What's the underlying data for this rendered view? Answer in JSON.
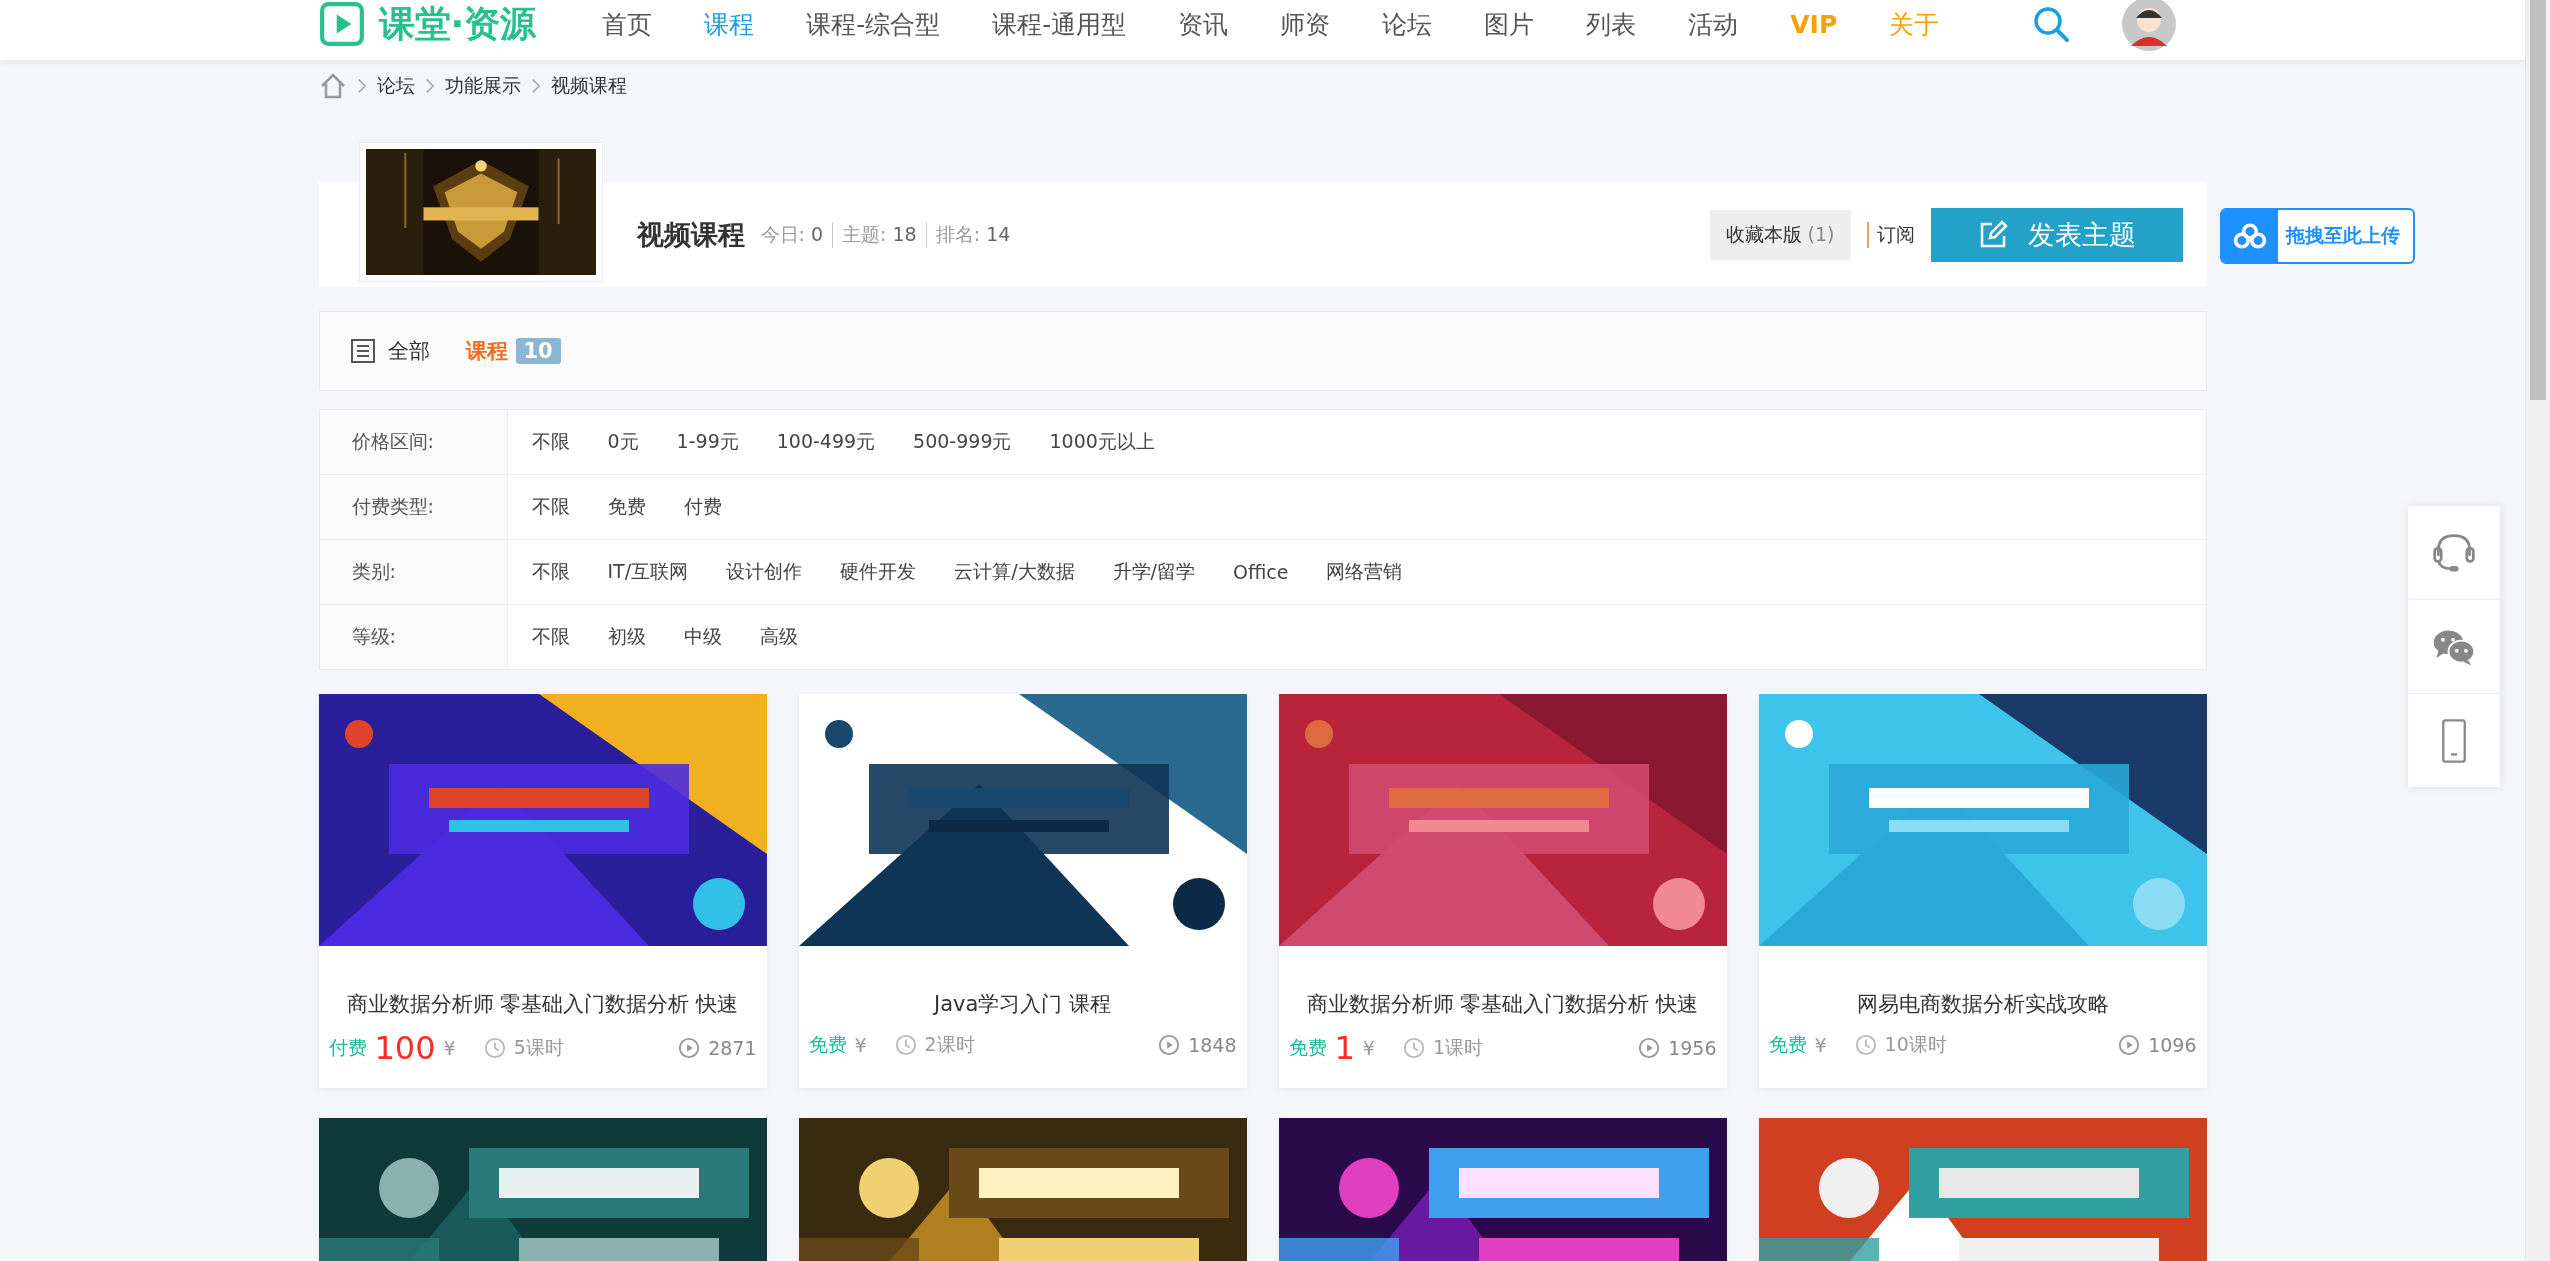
{
  "nav": {
    "logo": "课堂·资源",
    "items": [
      {
        "label": "首页",
        "selected": false,
        "kind": "normal"
      },
      {
        "label": "课程",
        "selected": true,
        "kind": "normal"
      },
      {
        "label": "课程-综合型",
        "selected": false,
        "kind": "normal"
      },
      {
        "label": "课程-通用型",
        "selected": false,
        "kind": "normal"
      },
      {
        "label": "资讯",
        "selected": false,
        "kind": "normal"
      },
      {
        "label": "师资",
        "selected": false,
        "kind": "normal"
      },
      {
        "label": "论坛",
        "selected": false,
        "kind": "normal"
      },
      {
        "label": "图片",
        "selected": false,
        "kind": "normal"
      },
      {
        "label": "列表",
        "selected": false,
        "kind": "normal"
      },
      {
        "label": "活动",
        "selected": false,
        "kind": "normal"
      },
      {
        "label": "VIP",
        "selected": false,
        "kind": "vip"
      },
      {
        "label": "关于",
        "selected": false,
        "kind": "highlight"
      }
    ]
  },
  "breadcrumb": [
    "论坛",
    "功能展示",
    "视频课程"
  ],
  "forum": {
    "title": "视频课程",
    "stats": [
      {
        "label": "今日:",
        "value": "0"
      },
      {
        "label": "主题:",
        "value": "18"
      },
      {
        "label": "排名:",
        "value": "14"
      }
    ],
    "favorite": {
      "label": "收藏本版",
      "count": "(1)"
    },
    "subscribe": "订阅",
    "post_button": "发表主题"
  },
  "upload_button": "拖拽至此上传",
  "tabs": [
    {
      "label": "全部",
      "selected": false
    },
    {
      "label": "课程",
      "selected": true,
      "count": "10"
    }
  ],
  "filters": [
    {
      "label": "价格区间:",
      "options": [
        "不限",
        "0元",
        "1-99元",
        "100-499元",
        "500-999元",
        "1000元以上"
      ]
    },
    {
      "label": "付费类型:",
      "options": [
        "不限",
        "免费",
        "付费"
      ]
    },
    {
      "label": "类别:",
      "options": [
        "不限",
        "IT/互联网",
        "设计创作",
        "硬件开发",
        "云计算/大数据",
        "升学/留学",
        "Office",
        "网络营销"
      ]
    },
    {
      "label": "等级:",
      "options": [
        "不限",
        "初级",
        "中级",
        "高级"
      ]
    }
  ],
  "courses": [
    {
      "title": "商业数据分析师 零基础入门数据分析 快速",
      "fee_type": "付费",
      "price": "100",
      "currency": "¥",
      "lessons": "5课时",
      "views": "2871"
    },
    {
      "title": "Java学习入门 课程",
      "fee_type": "免费",
      "currency": "¥",
      "lessons": "2课时",
      "views": "1848"
    },
    {
      "title": "商业数据分析师 零基础入门数据分析 快速",
      "fee_type": "免费",
      "price": "1",
      "currency": "¥",
      "lessons": "1课时",
      "views": "1956"
    },
    {
      "title": "网易电商数据分析实战攻略",
      "fee_type": "免费",
      "currency": "¥",
      "lessons": "10课时",
      "views": "1096"
    }
  ],
  "more_courses": [
    {
      "kind": "picture"
    },
    {
      "kind": "picture"
    },
    {
      "kind": "picture"
    },
    {
      "kind": "picture"
    }
  ]
}
